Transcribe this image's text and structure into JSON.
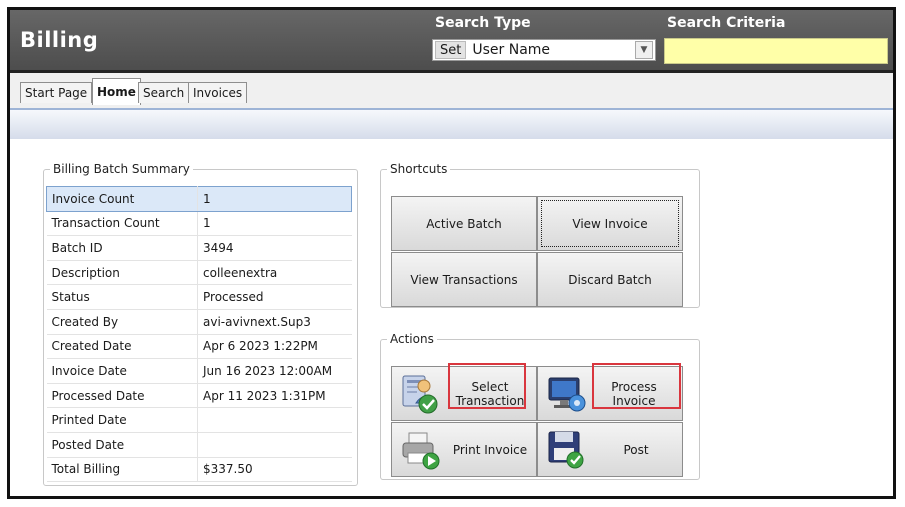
{
  "header": {
    "title": "Billing",
    "search_type_label": "Search Type",
    "search_criteria_label": "Search Criteria",
    "set_button": "Set",
    "search_type_value": "User Name",
    "search_criteria_value": ""
  },
  "tabs": [
    {
      "label": "Start Page",
      "active": false
    },
    {
      "label": "Home",
      "active": true
    },
    {
      "label": "Search",
      "active": false
    },
    {
      "label": "Invoices",
      "active": false
    }
  ],
  "summary": {
    "legend": "Billing Batch Summary",
    "rows": [
      {
        "label": "Invoice Count",
        "value": "1"
      },
      {
        "label": "Transaction Count",
        "value": "1"
      },
      {
        "label": "Batch ID",
        "value": "3494"
      },
      {
        "label": "Description",
        "value": "colleenextra"
      },
      {
        "label": "Status",
        "value": "Processed"
      },
      {
        "label": "Created By",
        "value": "avi-avivnext.Sup3"
      },
      {
        "label": "Created Date",
        "value": "Apr  6 2023  1:22PM"
      },
      {
        "label": "Invoice Date",
        "value": "Jun 16 2023 12:00AM"
      },
      {
        "label": "Processed Date",
        "value": "Apr 11 2023  1:31PM"
      },
      {
        "label": "Printed Date",
        "value": ""
      },
      {
        "label": "Posted Date",
        "value": ""
      },
      {
        "label": "Total Billing",
        "value": "$337.50"
      }
    ]
  },
  "shortcuts": {
    "legend": "Shortcuts",
    "active_batch": "Active Batch",
    "view_invoice": "View Invoice",
    "view_transactions": "View Transactions",
    "discard_batch": "Discard Batch"
  },
  "actions": {
    "legend": "Actions",
    "select_transaction": "Select Transaction",
    "process_invoice": "Process Invoice",
    "print_invoice": "Print Invoice",
    "post": "Post"
  },
  "colors": {
    "header_bg": "#575757",
    "criteria_bg": "#ffffa8",
    "highlight": "#d9363e",
    "selected_row": "#dbe8f8"
  }
}
